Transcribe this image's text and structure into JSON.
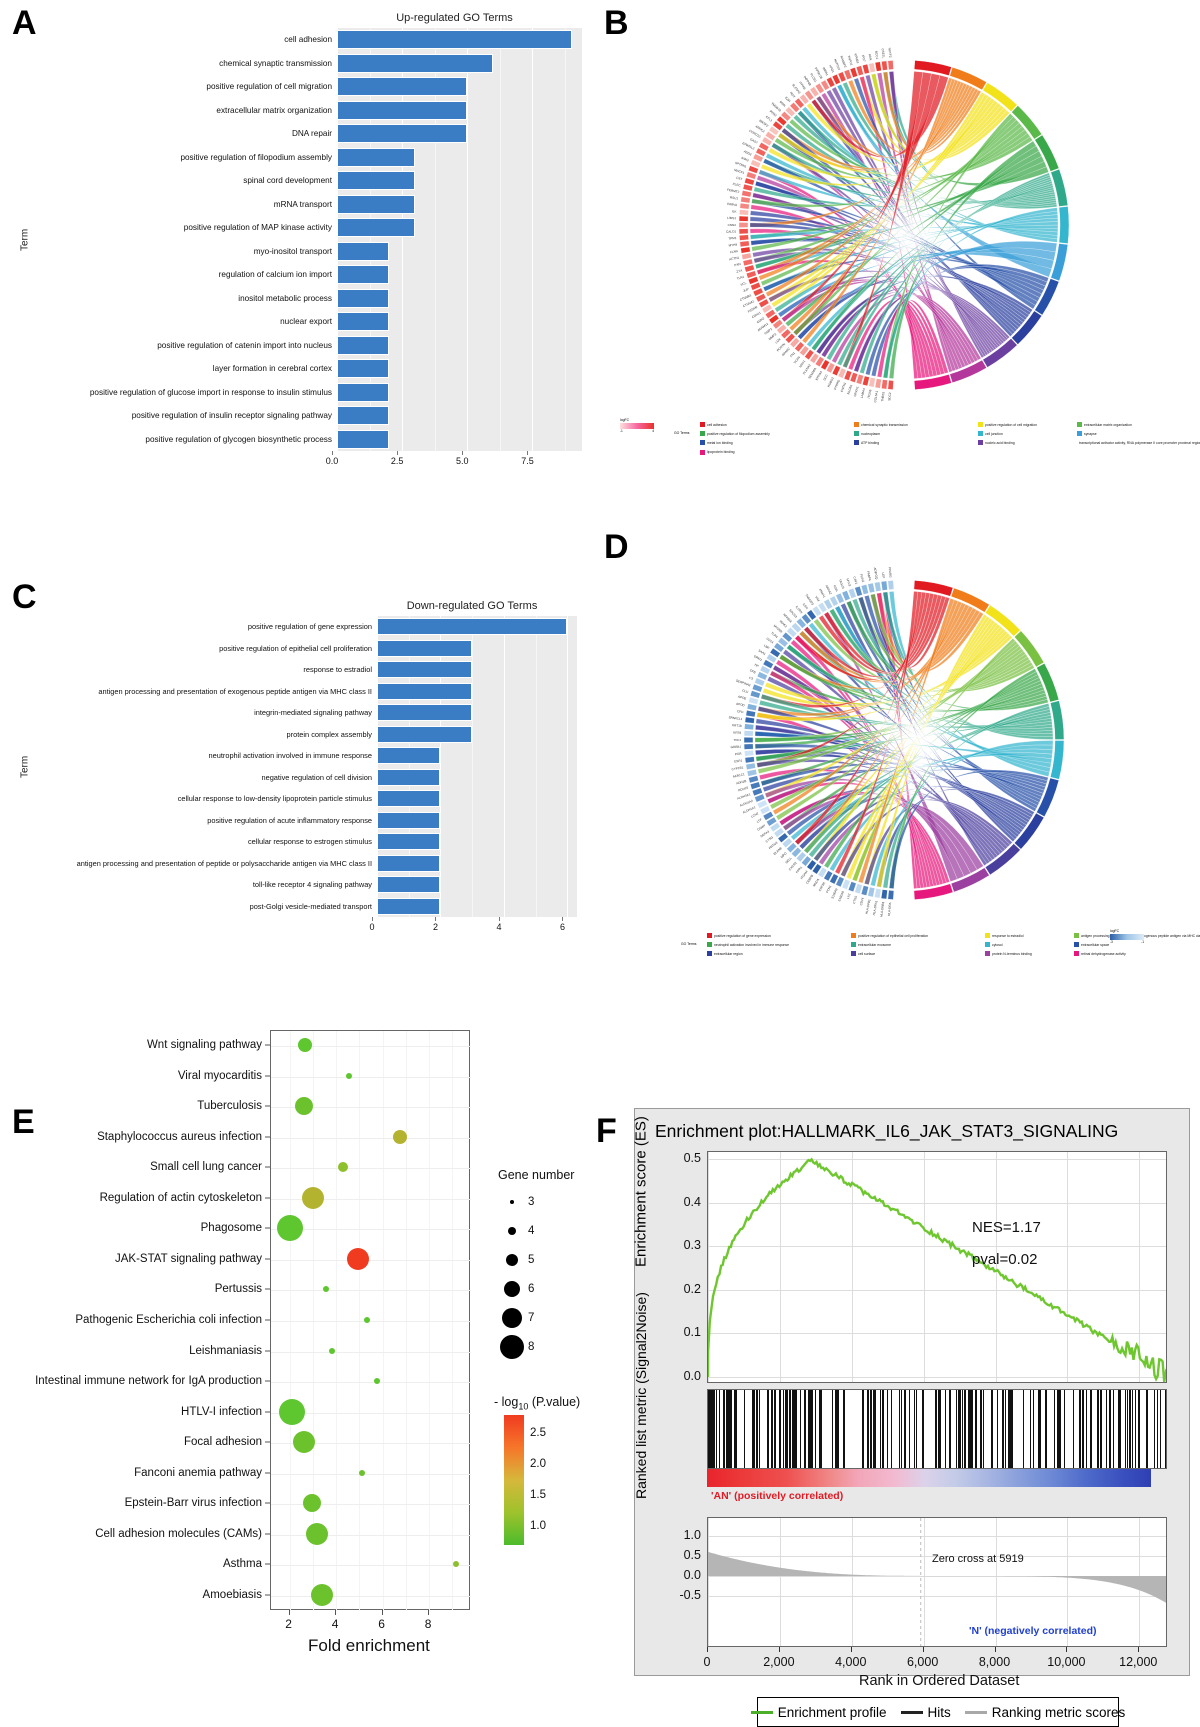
{
  "panels": {
    "A": {
      "letter": "A"
    },
    "B": {
      "letter": "B"
    },
    "C": {
      "letter": "C"
    },
    "D": {
      "letter": "D"
    },
    "E": {
      "letter": "E"
    },
    "F": {
      "letter": "F"
    }
  },
  "chart_data": [
    {
      "id": "panelA",
      "type": "bar",
      "orientation": "horizontal",
      "title": "Up-regulated GO Terms",
      "ylabel": "Term",
      "xlabel": "",
      "xlim": [
        0,
        9.4
      ],
      "xticks": [
        0.0,
        2.5,
        5.0,
        7.5
      ],
      "xticklabels": [
        "0.0",
        "2.5",
        "5.0",
        "7.5"
      ],
      "grid": true,
      "bar_color": "#3b7dc4",
      "categories": [
        "cell adhesion",
        "chemical synaptic transmission",
        "positive regulation of cell migration",
        "extracellular matrix organization",
        "DNA repair",
        "positive regulation of filopodium assembly",
        "spinal cord development",
        "mRNA transport",
        "positive regulation of MAP kinase activity",
        "myo-inositol transport",
        "regulation of calcium ion import",
        "inositol metabolic process",
        "nuclear export",
        "positive regulation of catenin import into nucleus",
        "layer formation in cerebral cortex",
        "positive regulation of glucose import in response to insulin stimulus",
        "positive regulation of insulin receptor signaling pathway",
        "positive regulation of glycogen biosynthetic process"
      ],
      "values": [
        9,
        6,
        5,
        5,
        5,
        3,
        3,
        3,
        3,
        2,
        2,
        2,
        2,
        2,
        2,
        2,
        2,
        2
      ]
    },
    {
      "id": "panelC",
      "type": "bar",
      "orientation": "horizontal",
      "title": "Down-regulated GO Terms",
      "ylabel": "Term",
      "xlabel": "",
      "xlim": [
        0,
        6.3
      ],
      "xticks": [
        0,
        2,
        4,
        6
      ],
      "xticklabels": [
        "0",
        "2",
        "4",
        "6"
      ],
      "grid": true,
      "bar_color": "#3b7dc4",
      "categories": [
        "positive regulation of gene expression",
        "positive regulation of epithelial cell proliferation",
        "response to estradiol",
        "antigen processing and presentation of exogenous peptide antigen via MHC class II",
        "integrin-mediated signaling pathway",
        "protein complex assembly",
        "neutrophil activation involved in immune response",
        "negative regulation of cell division",
        "cellular response to low-density lipoprotein particle stimulus",
        "positive regulation of acute inflammatory response",
        "cellular response to estrogen stimulus",
        "antigen processing and presentation of peptide or polysaccharide antigen via MHC class II",
        "toll-like receptor 4 signaling pathway",
        "post-Golgi vesicle-mediated transport"
      ],
      "values": [
        6,
        3,
        3,
        3,
        3,
        3,
        2,
        2,
        2,
        2,
        2,
        2,
        2,
        2
      ]
    },
    {
      "id": "panelE",
      "type": "scatter",
      "title": "",
      "xlabel": "Fold enrichment",
      "ylabel": "",
      "xlim": [
        1.2,
        9.8
      ],
      "xticks": [
        2,
        4,
        6,
        8
      ],
      "xticklabels": [
        "2",
        "4",
        "6",
        "8"
      ],
      "grid": true,
      "size_legend_title": "Gene number",
      "size_legend_values": [
        3,
        4,
        5,
        6,
        7,
        8
      ],
      "color_legend_title": "- log10 (P.value)",
      "color_legend_ticks": [
        "2.5",
        "2.0",
        "1.5",
        "1.0"
      ],
      "color_scale": [
        "#f03b20",
        "#f6762a",
        "#d6b83a",
        "#9ec22c",
        "#4cbb2c"
      ],
      "categories": [
        "Wnt signaling pathway",
        "Viral myocarditis",
        "Tuberculosis",
        "Staphylococcus aureus infection",
        "Small cell lung cancer",
        "Regulation of actin cytoskeleton",
        "Phagosome",
        "JAK-STAT signaling pathway",
        "Pertussis",
        "Pathogenic Escherichia coli infection",
        "Leishmaniasis",
        "Intestinal immune network for IgA production",
        "HTLV-I infection",
        "Focal adhesion",
        "Fanconi anemia pathway",
        "Epstein-Barr virus infection",
        "Cell adhesion molecules (CAMs)",
        "Asthma",
        "Amoebiasis"
      ],
      "points": [
        {
          "term": "Wnt signaling pathway",
          "fold": 2.7,
          "gene_number": 5,
          "neglog10p": 1.2,
          "color": "#5ec62e"
        },
        {
          "term": "Viral myocarditis",
          "fold": 4.6,
          "gene_number": 3,
          "neglog10p": 1.05,
          "color": "#5ec62e"
        },
        {
          "term": "Tuberculosis",
          "fold": 2.65,
          "gene_number": 6,
          "neglog10p": 1.25,
          "color": "#6cc22c"
        },
        {
          "term": "Staphylococcus aureus infection",
          "fold": 6.8,
          "gene_number": 5,
          "neglog10p": 1.85,
          "color": "#b4b32f"
        },
        {
          "term": "Small cell lung cancer",
          "fold": 4.35,
          "gene_number": 4,
          "neglog10p": 1.4,
          "color": "#8ec02d"
        },
        {
          "term": "Regulation of actin cytoskeleton",
          "fold": 3.05,
          "gene_number": 7,
          "neglog10p": 1.9,
          "color": "#b4b32f"
        },
        {
          "term": "Phagosome",
          "fold": 2.05,
          "gene_number": 8,
          "neglog10p": 1.2,
          "color": "#5ec62e"
        },
        {
          "term": "JAK-STAT signaling pathway",
          "fold": 5.0,
          "gene_number": 7,
          "neglog10p": 2.85,
          "color": "#f03b20"
        },
        {
          "term": "Pertussis",
          "fold": 3.6,
          "gene_number": 3,
          "neglog10p": 1.05,
          "color": "#5ec62e"
        },
        {
          "term": "Pathogenic Escherichia coli infection",
          "fold": 5.35,
          "gene_number": 3,
          "neglog10p": 1.1,
          "color": "#5ec62e"
        },
        {
          "term": "Leishmaniasis",
          "fold": 3.85,
          "gene_number": 3,
          "neglog10p": 1.05,
          "color": "#5ec62e"
        },
        {
          "term": "Intestinal immune network for IgA production",
          "fold": 5.8,
          "gene_number": 3,
          "neglog10p": 1.1,
          "color": "#5ec62e"
        },
        {
          "term": "HTLV-I infection",
          "fold": 2.15,
          "gene_number": 8,
          "neglog10p": 1.25,
          "color": "#5ec62e"
        },
        {
          "term": "Focal adhesion",
          "fold": 2.65,
          "gene_number": 7,
          "neglog10p": 1.2,
          "color": "#6cc22c"
        },
        {
          "term": "Fanconi anemia pathway",
          "fold": 5.15,
          "gene_number": 3,
          "neglog10p": 1.05,
          "color": "#6cc22c"
        },
        {
          "term": "Epstein-Barr virus infection",
          "fold": 3.0,
          "gene_number": 6,
          "neglog10p": 1.2,
          "color": "#6cc22c"
        },
        {
          "term": "Cell adhesion molecules (CAMs)",
          "fold": 3.2,
          "gene_number": 7,
          "neglog10p": 1.2,
          "color": "#6cc22c"
        },
        {
          "term": "Asthma",
          "fold": 9.2,
          "gene_number": 3,
          "neglog10p": 1.05,
          "color": "#8ec02d"
        },
        {
          "term": "Amoebiasis",
          "fold": 3.45,
          "gene_number": 7,
          "neglog10p": 1.2,
          "color": "#6cc22c"
        }
      ]
    },
    {
      "id": "panelF",
      "type": "line",
      "title": "Enrichment plot:HALLMARK_IL6_JAK_STAT3_SIGNALING",
      "xlabel": "Rank in Ordered Dataset",
      "ylabel_top": "Enrichment score (ES)",
      "ylabel_bottom": "Ranked list metric (Signal2Noise)",
      "xlim": [
        0,
        12800
      ],
      "xticks": [
        0,
        2000,
        4000,
        6000,
        8000,
        10000,
        12000
      ],
      "xticklabels": [
        "0",
        "2,000",
        "4,000",
        "6,000",
        "8,000",
        "10,000",
        "12,000"
      ],
      "es_yticks": [
        "0.0",
        "0.1",
        "0.2",
        "0.3",
        "0.4",
        "0.5"
      ],
      "metric_yticks": [
        "1.0",
        "0.5",
        "0.0",
        "-0.5"
      ],
      "annotations": {
        "nes": "NES=1.17",
        "pval": "pval=0.02",
        "zero_cross": "Zero cross at 5919",
        "pos_label": "'AN' (positively correlated)",
        "neg_label": "'N' (negatively correlated)"
      },
      "legend": [
        {
          "label": "Enrichment profile",
          "color": "#4caf2a"
        },
        {
          "label": "Hits",
          "color": "#222222"
        },
        {
          "label": "Ranking metric scores",
          "color": "#a8a8a8"
        }
      ],
      "line_color": "#6ec72e"
    }
  ],
  "chord_B": {
    "logfc_legend_title": "logFC",
    "logfc_min": "-1",
    "logfc_max": "4",
    "go_terms_label": "GO Terms",
    "gradient": [
      "#fde0dd",
      "#f768a1",
      "#e8322a"
    ],
    "terms": [
      {
        "label": "cell adhesion",
        "color": "#e11a22"
      },
      {
        "label": "chemical synaptic transmission",
        "color": "#f07d1a"
      },
      {
        "label": "positive regulation of cell migration",
        "color": "#f2e21a"
      },
      {
        "label": "extracellular matrix organization",
        "color": "#5bb94a"
      },
      {
        "label": "positive regulation of filopodium assembly",
        "color": "#39a84a"
      },
      {
        "label": "nucleoplasm",
        "color": "#2fa98a"
      },
      {
        "label": "cell junction",
        "color": "#35b6cf"
      },
      {
        "label": "synapse",
        "color": "#3a9fd8"
      },
      {
        "label": "metal ion binding",
        "color": "#2750a8"
      },
      {
        "label": "ATP binding",
        "color": "#2b3f9e"
      },
      {
        "label": "nucleic acid binding",
        "color": "#6b3fa0"
      },
      {
        "label": "transcriptional activator activity, RNA polymerase II core promoter proximal region sequence-specific binding",
        "color": "#b4379b"
      },
      {
        "label": "lipoprotein binding",
        "color": "#e6187d"
      }
    ],
    "outer_genes": [
      "SDC2",
      "THBS1",
      "COL5A1",
      "ITGA5",
      "LAMA4",
      "NRXN1",
      "NLGN1",
      "CNTN1",
      "PTPRD",
      "ROBO2",
      "DCC",
      "EPHA4",
      "SEMA6A",
      "PLXNA2",
      "NRP1",
      "VCAN",
      "FN1",
      "SPARC",
      "POSTN",
      "LOX",
      "MMP2",
      "TIMP2",
      "ADAM12",
      "CDH2",
      "CDH11",
      "PCDH9",
      "CTNNA1",
      "CTNNB1",
      "JUP",
      "VCL",
      "TLN1",
      "ZYX",
      "PXN",
      "ACTN1",
      "FLNA",
      "MYH9",
      "TPM1",
      "CALD1",
      "CNN2",
      "LIMS1",
      "ILK",
      "PARVA",
      "RSU1",
      "FERMT2",
      "PLEC",
      "DST",
      "MACF1",
      "SPTBN1",
      "ANK2",
      "ADD3",
      "EPB41L2",
      "GAS7",
      "CORO1C",
      "ARPC2",
      "WASF2",
      "CFL1",
      "PFN2",
      "TMSB10",
      "MSN",
      "EZR",
      "RDX",
      "SLC5A3",
      "ITPKB",
      "INPP4B",
      "PLCB1",
      "PIP5K1B",
      "IMPA1",
      "XPO1",
      "NUP214",
      "RANBP2",
      "TNPO1",
      "KPNB1",
      "IPO7",
      "RAN",
      "RCC1",
      "CSE1L",
      "NUTF2"
    ]
  },
  "chord_D": {
    "logfc_legend_title": "logFC",
    "logfc_min": "-3",
    "logfc_max": "-1",
    "go_terms_label": "GO Terms",
    "gradient": [
      "#2b5fa8",
      "#9ec6e6",
      "#dcebf7"
    ],
    "terms": [
      {
        "label": "positive regulation of gene expression",
        "color": "#e11a22"
      },
      {
        "label": "positive regulation of epithelial cell proliferation",
        "color": "#f07d1a"
      },
      {
        "label": "response to estradiol",
        "color": "#f2e21a"
      },
      {
        "label": "antigen processing and presentation of exogenous peptide antigen via MHC class II",
        "color": "#7ac143"
      },
      {
        "label": "neutrophil activation involved in immune response",
        "color": "#39a84a"
      },
      {
        "label": "extracellular exosome",
        "color": "#2fa98a"
      },
      {
        "label": "cytosol",
        "color": "#35b6cf"
      },
      {
        "label": "extracellular space",
        "color": "#2750a8"
      },
      {
        "label": "extracellular region",
        "color": "#2b3f9e"
      },
      {
        "label": "cell surface",
        "color": "#4b3f9e"
      },
      {
        "label": "protein N-terminus binding",
        "color": "#9b3fa0"
      },
      {
        "label": "retinal dehydrogenase activity",
        "color": "#e6187d"
      }
    ],
    "outer_genes": [
      "HLA-DRA",
      "HLA-DRB1",
      "HLA-DPA1",
      "HLA-DPB1",
      "CD74",
      "CTSS",
      "LYZ",
      "S100A8",
      "S100A9",
      "FCN1",
      "CSF3R",
      "MNDA",
      "CEBPB",
      "ITGAM",
      "FPR1",
      "CXCR2",
      "SELL",
      "MPO",
      "ELANE",
      "PRTN3",
      "CTSG",
      "DEFA3",
      "CAMP",
      "LTF",
      "LCN2",
      "ALDH1A1",
      "ALDH1A2",
      "ALDH3A1",
      "RDH10",
      "ADH1B",
      "AKR1C1",
      "CYP1B1",
      "ESR1",
      "PGR",
      "GREB1",
      "TFF1",
      "KRT8",
      "KRT18",
      "SPARCL1",
      "CFD",
      "APOD",
      "APOE",
      "CLU",
      "SERPINA3",
      "C3",
      "CFB",
      "HP",
      "ORM1",
      "SAA1",
      "LBP",
      "CD14",
      "TLR4",
      "MYD88",
      "IRAK3",
      "NFKBIA",
      "SOCS3",
      "IL1RN",
      "IL6R",
      "TNFAIP3",
      "VIM",
      "ANXA1",
      "ANXA2",
      "GSN",
      "TAGLN",
      "MYL9",
      "CAV1",
      "PLIN2",
      "FABP4",
      "ADIPOQ",
      "LEP",
      "PPARG"
    ]
  }
}
